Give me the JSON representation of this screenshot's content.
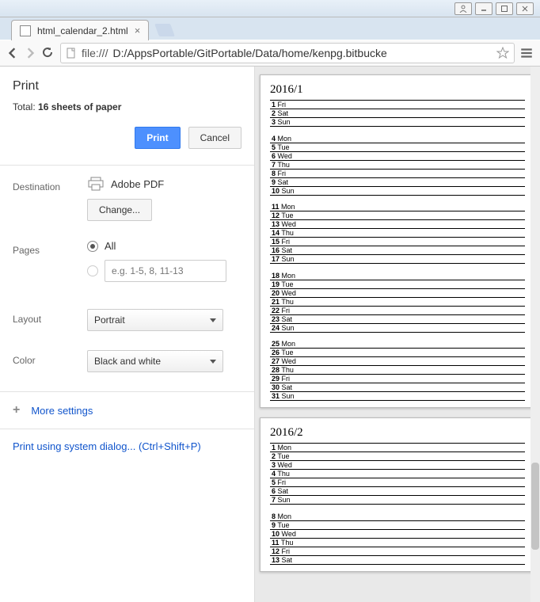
{
  "window": {
    "tab_title": "html_calendar_2.html",
    "url_protocol": "file:///",
    "url_path": "D:/AppsPortable/GitPortable/Data/home/kenpg.bitbucke"
  },
  "print": {
    "title": "Print",
    "total_prefix": "Total: ",
    "total_value": "16 sheets of paper",
    "print_btn": "Print",
    "cancel_btn": "Cancel",
    "destination_label": "Destination",
    "destination_value": "Adobe PDF",
    "change_btn": "Change...",
    "pages_label": "Pages",
    "pages_all": "All",
    "pages_placeholder": "e.g. 1-5, 8, 11-13",
    "layout_label": "Layout",
    "layout_value": "Portrait",
    "color_label": "Color",
    "color_value": "Black and white",
    "more_settings": "More settings",
    "system_dialog": "Print using system dialog... (Ctrl+Shift+P)"
  },
  "calendar": {
    "months": [
      {
        "title": "2016/1",
        "weeks": [
          [
            {
              "d": "1",
              "w": "Fri"
            },
            {
              "d": "2",
              "w": "Sat"
            },
            {
              "d": "3",
              "w": "Sun"
            }
          ],
          [
            {
              "d": "4",
              "w": "Mon"
            },
            {
              "d": "5",
              "w": "Tue"
            },
            {
              "d": "6",
              "w": "Wed"
            },
            {
              "d": "7",
              "w": "Thu"
            },
            {
              "d": "8",
              "w": "Fri"
            },
            {
              "d": "9",
              "w": "Sat"
            },
            {
              "d": "10",
              "w": "Sun"
            }
          ],
          [
            {
              "d": "11",
              "w": "Mon"
            },
            {
              "d": "12",
              "w": "Tue"
            },
            {
              "d": "13",
              "w": "Wed"
            },
            {
              "d": "14",
              "w": "Thu"
            },
            {
              "d": "15",
              "w": "Fri"
            },
            {
              "d": "16",
              "w": "Sat"
            },
            {
              "d": "17",
              "w": "Sun"
            }
          ],
          [
            {
              "d": "18",
              "w": "Mon"
            },
            {
              "d": "19",
              "w": "Tue"
            },
            {
              "d": "20",
              "w": "Wed"
            },
            {
              "d": "21",
              "w": "Thu"
            },
            {
              "d": "22",
              "w": "Fri"
            },
            {
              "d": "23",
              "w": "Sat"
            },
            {
              "d": "24",
              "w": "Sun"
            }
          ],
          [
            {
              "d": "25",
              "w": "Mon"
            },
            {
              "d": "26",
              "w": "Tue"
            },
            {
              "d": "27",
              "w": "Wed"
            },
            {
              "d": "28",
              "w": "Thu"
            },
            {
              "d": "29",
              "w": "Fri"
            },
            {
              "d": "30",
              "w": "Sat"
            },
            {
              "d": "31",
              "w": "Sun"
            }
          ]
        ]
      },
      {
        "title": "2016/2",
        "weeks": [
          [
            {
              "d": "1",
              "w": "Mon"
            },
            {
              "d": "2",
              "w": "Tue"
            },
            {
              "d": "3",
              "w": "Wed"
            },
            {
              "d": "4",
              "w": "Thu"
            },
            {
              "d": "5",
              "w": "Fri"
            },
            {
              "d": "6",
              "w": "Sat"
            },
            {
              "d": "7",
              "w": "Sun"
            }
          ],
          [
            {
              "d": "8",
              "w": "Mon"
            },
            {
              "d": "9",
              "w": "Tue"
            },
            {
              "d": "10",
              "w": "Wed"
            },
            {
              "d": "11",
              "w": "Thu"
            },
            {
              "d": "12",
              "w": "Fri"
            },
            {
              "d": "13",
              "w": "Sat"
            }
          ]
        ]
      }
    ]
  }
}
